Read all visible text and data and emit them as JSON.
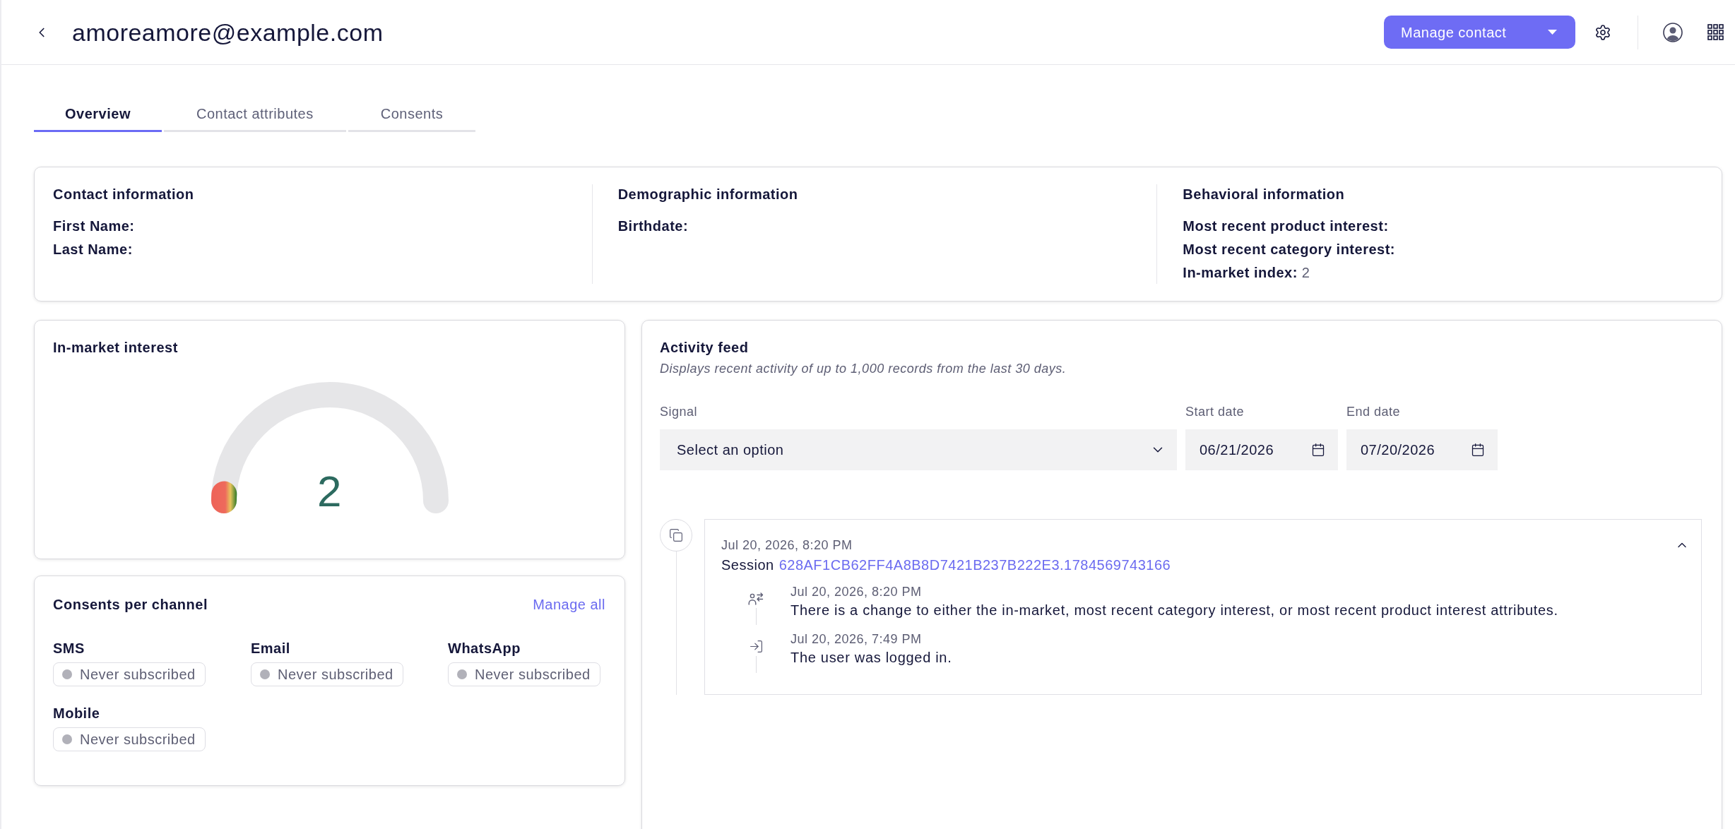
{
  "header": {
    "title": "amoreamore@example.com",
    "primary_button": "Manage contact"
  },
  "tabs": [
    {
      "label": "Overview",
      "selected": true
    },
    {
      "label": "Contact attributes",
      "selected": false
    },
    {
      "label": "Consents",
      "selected": false
    }
  ],
  "contact_summary": {
    "sections": [
      {
        "heading": "Contact information",
        "fields": [
          {
            "label": "First Name:"
          },
          {
            "label": "Last Name:"
          }
        ]
      },
      {
        "heading": "Demographic information",
        "fields": [
          {
            "label": "Birthdate:"
          }
        ]
      },
      {
        "heading": "Behavioral information",
        "fields": [
          {
            "label": "Most recent product interest:"
          },
          {
            "label": "Most recent category interest:"
          },
          {
            "label": "In-market index:",
            "value": "2"
          }
        ]
      }
    ]
  },
  "in_market_interest": {
    "title": "In-market interest",
    "gauge": {
      "level": 0.02,
      "reading": "2"
    }
  },
  "consents": {
    "title": "Consents per channel",
    "link": "Manage all",
    "channels": [
      {
        "name": "SMS",
        "status": "Never subscribed"
      },
      {
        "name": "Email",
        "status": "Never subscribed"
      },
      {
        "name": "WhatsApp",
        "status": "Never subscribed"
      },
      {
        "name": "Mobile",
        "status": "Never subscribed"
      }
    ]
  },
  "activity_feed": {
    "title": "Activity feed",
    "description": "Displays recent activity of up to 1,000 records from the last 30 days.",
    "filters": {
      "signal": {
        "label": "Signal",
        "placeholder": "Select an option"
      },
      "start_date": {
        "label": "Start date",
        "value": "06/21/2026"
      },
      "end_date": {
        "label": "End date",
        "value": "07/20/2026"
      }
    },
    "sessions": [
      {
        "timestamp": "Jul 20, 2026, 8:20 PM",
        "label": "Session",
        "session_id": "628AF1CB62FF4A8B8D7421B237B222E3.1784569743166",
        "expanded": true,
        "events": [
          {
            "kind": "attribute_change",
            "timestamp": "Jul 20, 2026, 8:20 PM",
            "text": "There is a change to either the in-market, most recent category interest, or most recent product interest attributes."
          },
          {
            "kind": "login",
            "timestamp": "Jul 20, 2026, 7:49 PM",
            "text": "The user was logged in."
          }
        ]
      }
    ]
  }
}
